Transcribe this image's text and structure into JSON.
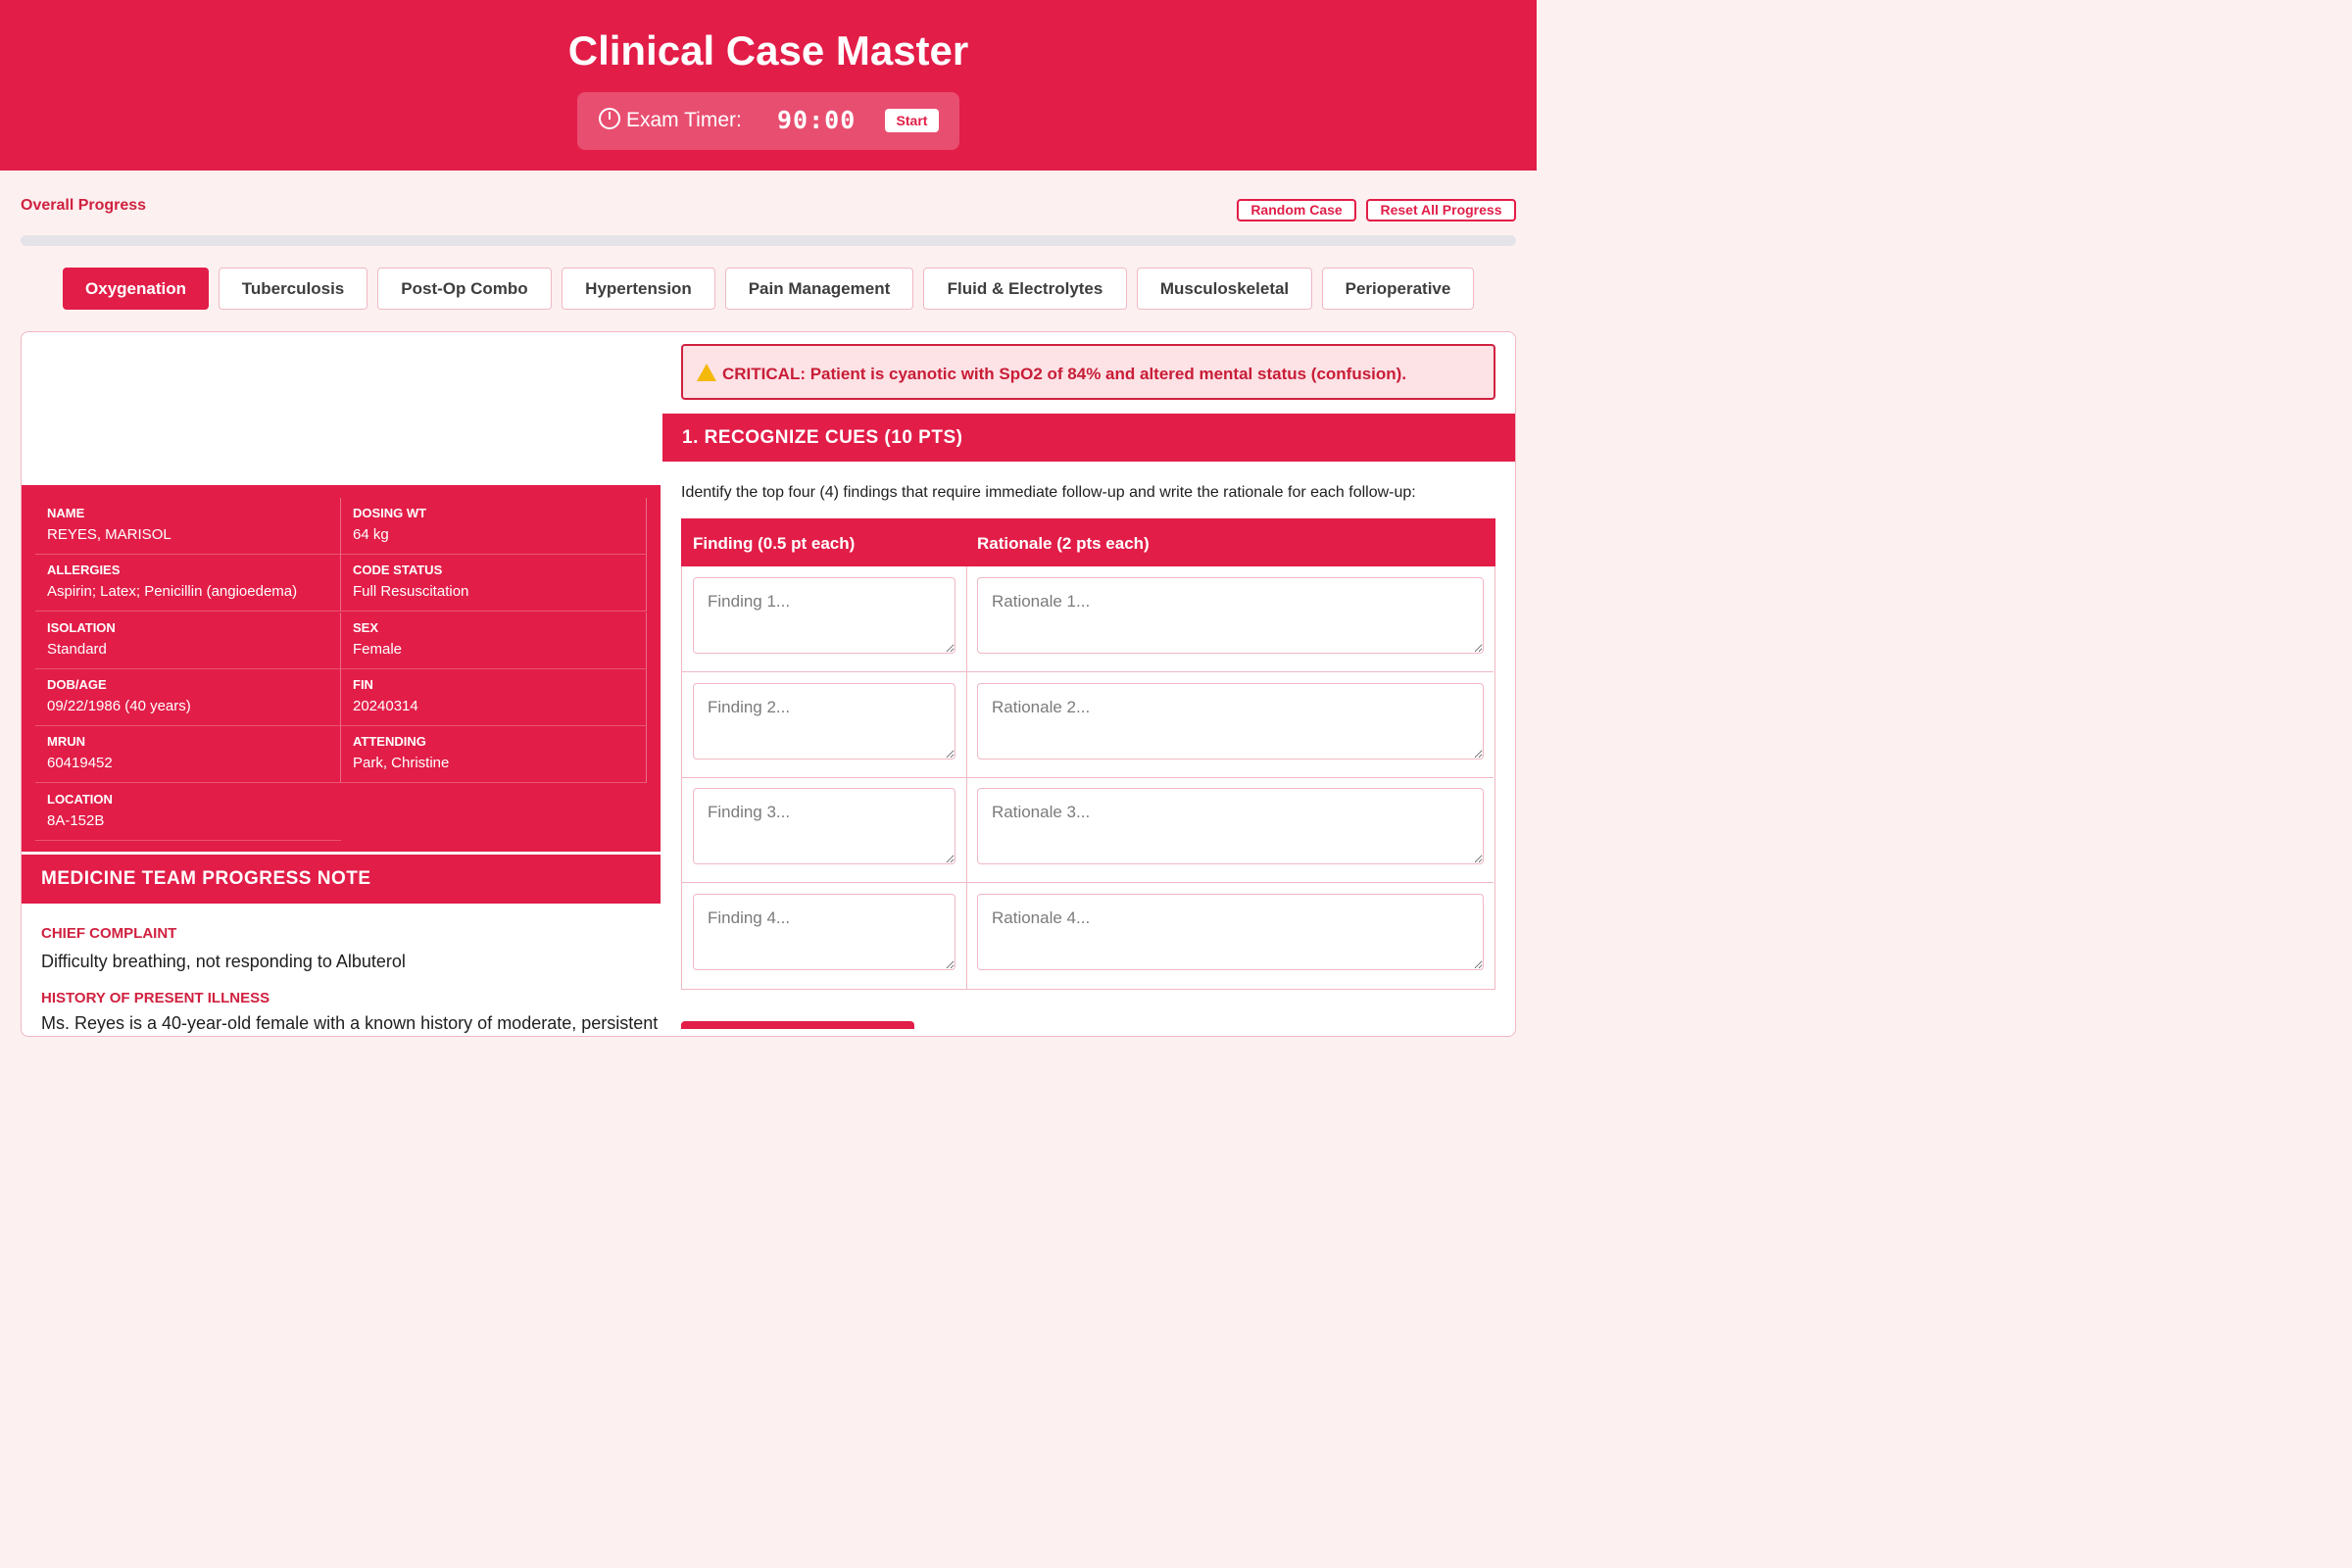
{
  "app": {
    "title": "Clinical Case Master"
  },
  "timer": {
    "label": "Exam Timer:",
    "value": "90:00",
    "start_label": "Start",
    "icon": "stopwatch-icon"
  },
  "progress": {
    "label": "Overall Progress",
    "fraction": 0
  },
  "actions": {
    "random_case": "Random Case",
    "reset_all": "Reset All Progress"
  },
  "tabs": [
    {
      "label": "Oxygenation",
      "active": true
    },
    {
      "label": "Tuberculosis",
      "active": false
    },
    {
      "label": "Post-Op Combo",
      "active": false
    },
    {
      "label": "Hypertension",
      "active": false
    },
    {
      "label": "Pain Management",
      "active": false
    },
    {
      "label": "Fluid & Electrolytes",
      "active": false
    },
    {
      "label": "Musculoskeletal",
      "active": false
    },
    {
      "label": "Perioperative",
      "active": false
    }
  ],
  "patient": {
    "name": {
      "key": "NAME",
      "value": "REYES, MARISOL"
    },
    "dosing_wt": {
      "key": "DOSING WT",
      "value": "64 kg"
    },
    "allergies": {
      "key": "ALLERGIES",
      "value": "Aspirin; Latex; Penicillin (angioedema)"
    },
    "code_status": {
      "key": "CODE STATUS",
      "value": "Full Resuscitation"
    },
    "isolation": {
      "key": "ISOLATION",
      "value": "Standard"
    },
    "sex": {
      "key": "SEX",
      "value": "Female"
    },
    "dob_age": {
      "key": "DOB/AGE",
      "value": "09/22/1986 (40 years)"
    },
    "fin": {
      "key": "FIN",
      "value": "20240314"
    },
    "mrun": {
      "key": "MRUN",
      "value": "60419452"
    },
    "attending": {
      "key": "ATTENDING",
      "value": "Park, Christine"
    },
    "location": {
      "key": "LOCATION",
      "value": "8A-152B"
    }
  },
  "note": {
    "title": "MEDICINE TEAM PROGRESS NOTE",
    "chief_complaint_label": "CHIEF COMPLAINT",
    "chief_complaint": "Difficulty breathing, not responding to Albuterol",
    "hpi_label": "HISTORY OF PRESENT ILLNESS",
    "hpi_partial": "Ms. Reyes is a 40-year-old female with a known history of moderate, persistent"
  },
  "alert": {
    "icon": "warning-icon",
    "text": "CRITICAL: Patient is cyanotic with SpO2 of 84% and altered mental status (confusion)."
  },
  "section": {
    "title": "1. RECOGNIZE CUES (10 PTS)",
    "instructions": "Identify the top four (4) findings that require immediate follow-up and write the rationale for each follow-up:",
    "col_finding": "Finding (0.5 pt each)",
    "col_rationale": "Rationale (2 pts each)",
    "rows": [
      {
        "finding_placeholder": "Finding 1...",
        "rationale_placeholder": "Rationale 1..."
      },
      {
        "finding_placeholder": "Finding 2...",
        "rationale_placeholder": "Rationale 2..."
      },
      {
        "finding_placeholder": "Finding 3...",
        "rationale_placeholder": "Rationale 3..."
      },
      {
        "finding_placeholder": "Finding 4...",
        "rationale_placeholder": "Rationale 4..."
      }
    ]
  },
  "colors": {
    "brand": "#e21d48",
    "alert_bg": "#fde2e6",
    "alert_text": "#c81d36",
    "page_bg": "#fdf0f0"
  }
}
